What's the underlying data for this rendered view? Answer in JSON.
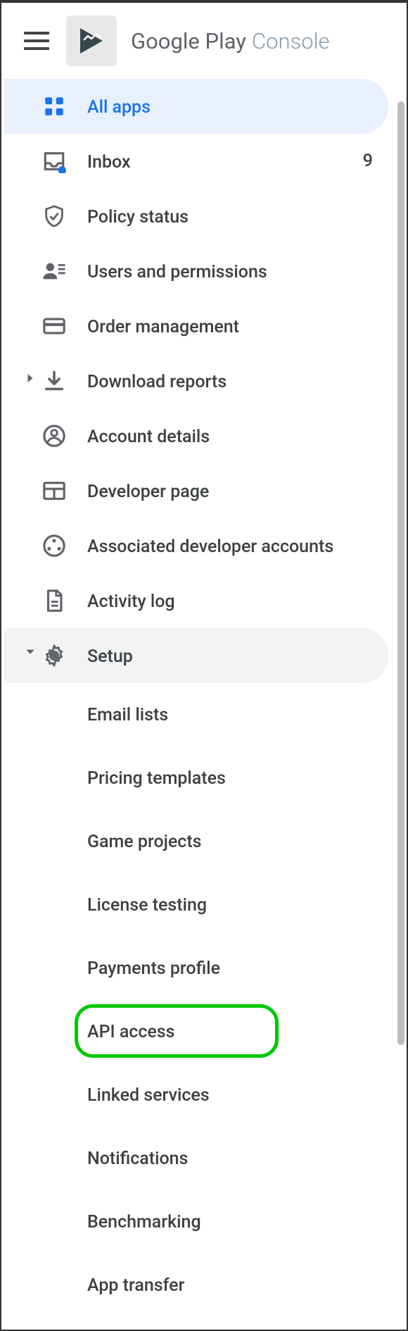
{
  "brand": {
    "play": "Google Play",
    "console": "Console"
  },
  "nav": {
    "all_apps": "All apps",
    "inbox": {
      "label": "Inbox",
      "badge": "9"
    },
    "policy_status": "Policy status",
    "users_permissions": "Users and permissions",
    "order_management": "Order management",
    "download_reports": "Download reports",
    "account_details": "Account details",
    "developer_page": "Developer page",
    "associated_dev": "Associated developer accounts",
    "activity_log": "Activity log",
    "setup": "Setup"
  },
  "setup_sub": {
    "email_lists": "Email lists",
    "pricing_templates": "Pricing templates",
    "game_projects": "Game projects",
    "license_testing": "License testing",
    "payments_profile": "Payments profile",
    "api_access": "API access",
    "linked_services": "Linked services",
    "notifications": "Notifications",
    "benchmarking": "Benchmarking",
    "app_transfer": "App transfer"
  }
}
